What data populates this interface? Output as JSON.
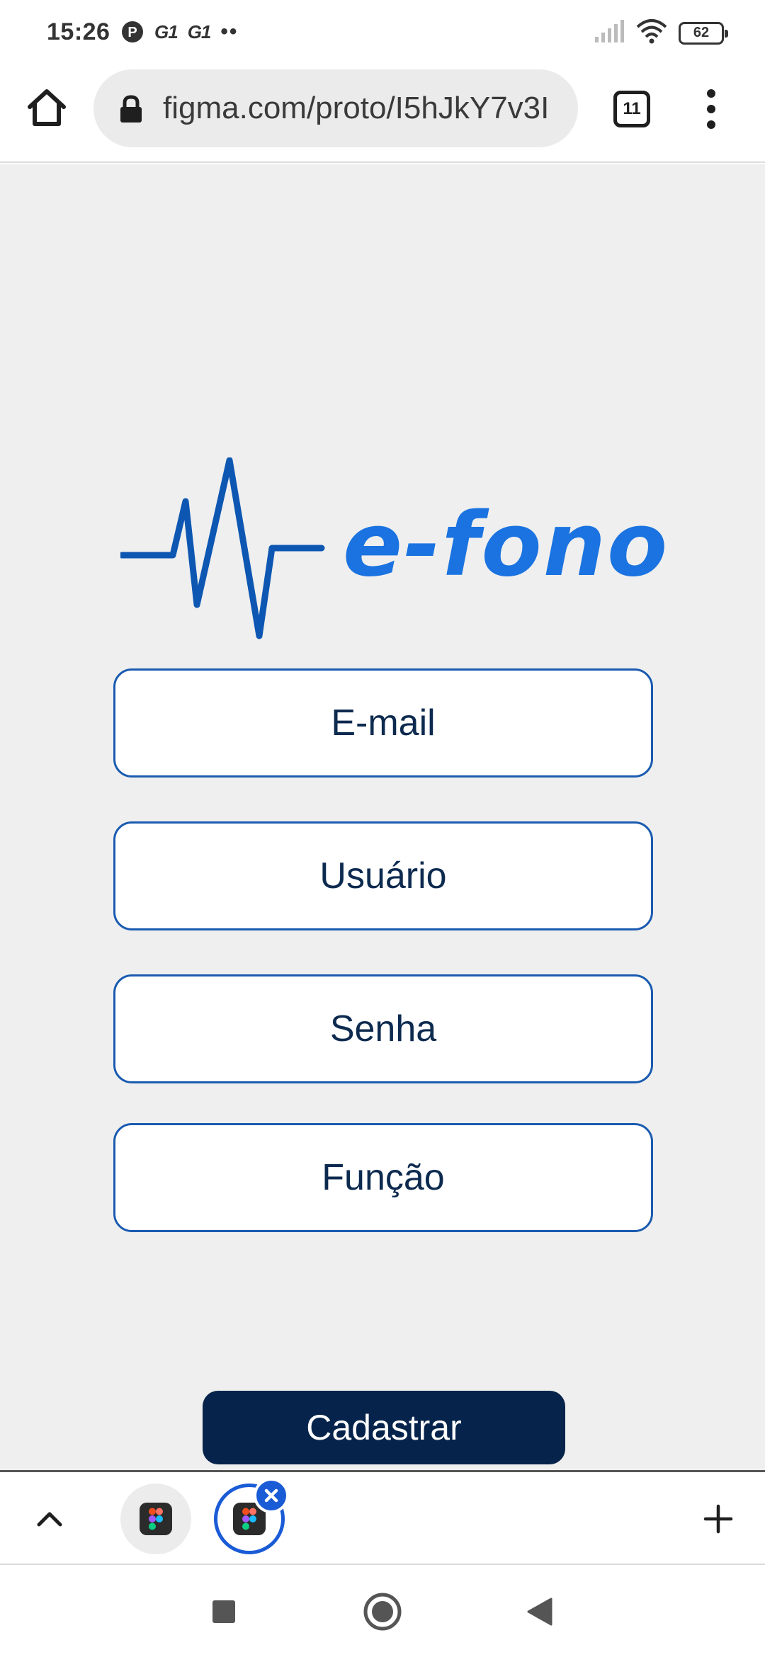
{
  "status_bar": {
    "time": "15:26",
    "notif_g1_a": "G1",
    "notif_g1_b": "G1",
    "more_dots": "••",
    "battery_level": "62"
  },
  "browser": {
    "url": "figma.com/proto/I5hJkY7v3I",
    "tab_count": "11"
  },
  "app": {
    "logo_text": "e-fono",
    "brand_color": "#1a73e0",
    "logo_pulse_color": "#0d57b3",
    "fields": {
      "email": "E-mail",
      "username": "Usuário",
      "password": "Senha",
      "role": "Função"
    },
    "submit_label": "Cadastrar"
  },
  "tab_group": {
    "tabs": [
      {
        "icon": "figma-icon",
        "selected": false
      },
      {
        "icon": "figma-icon",
        "selected": true
      }
    ]
  },
  "colors": {
    "field_border": "#1a5bb0",
    "field_text": "#0d2a4f",
    "button_bg": "#06244b",
    "page_bg": "#efefef",
    "accent": "#1a5bd6"
  }
}
